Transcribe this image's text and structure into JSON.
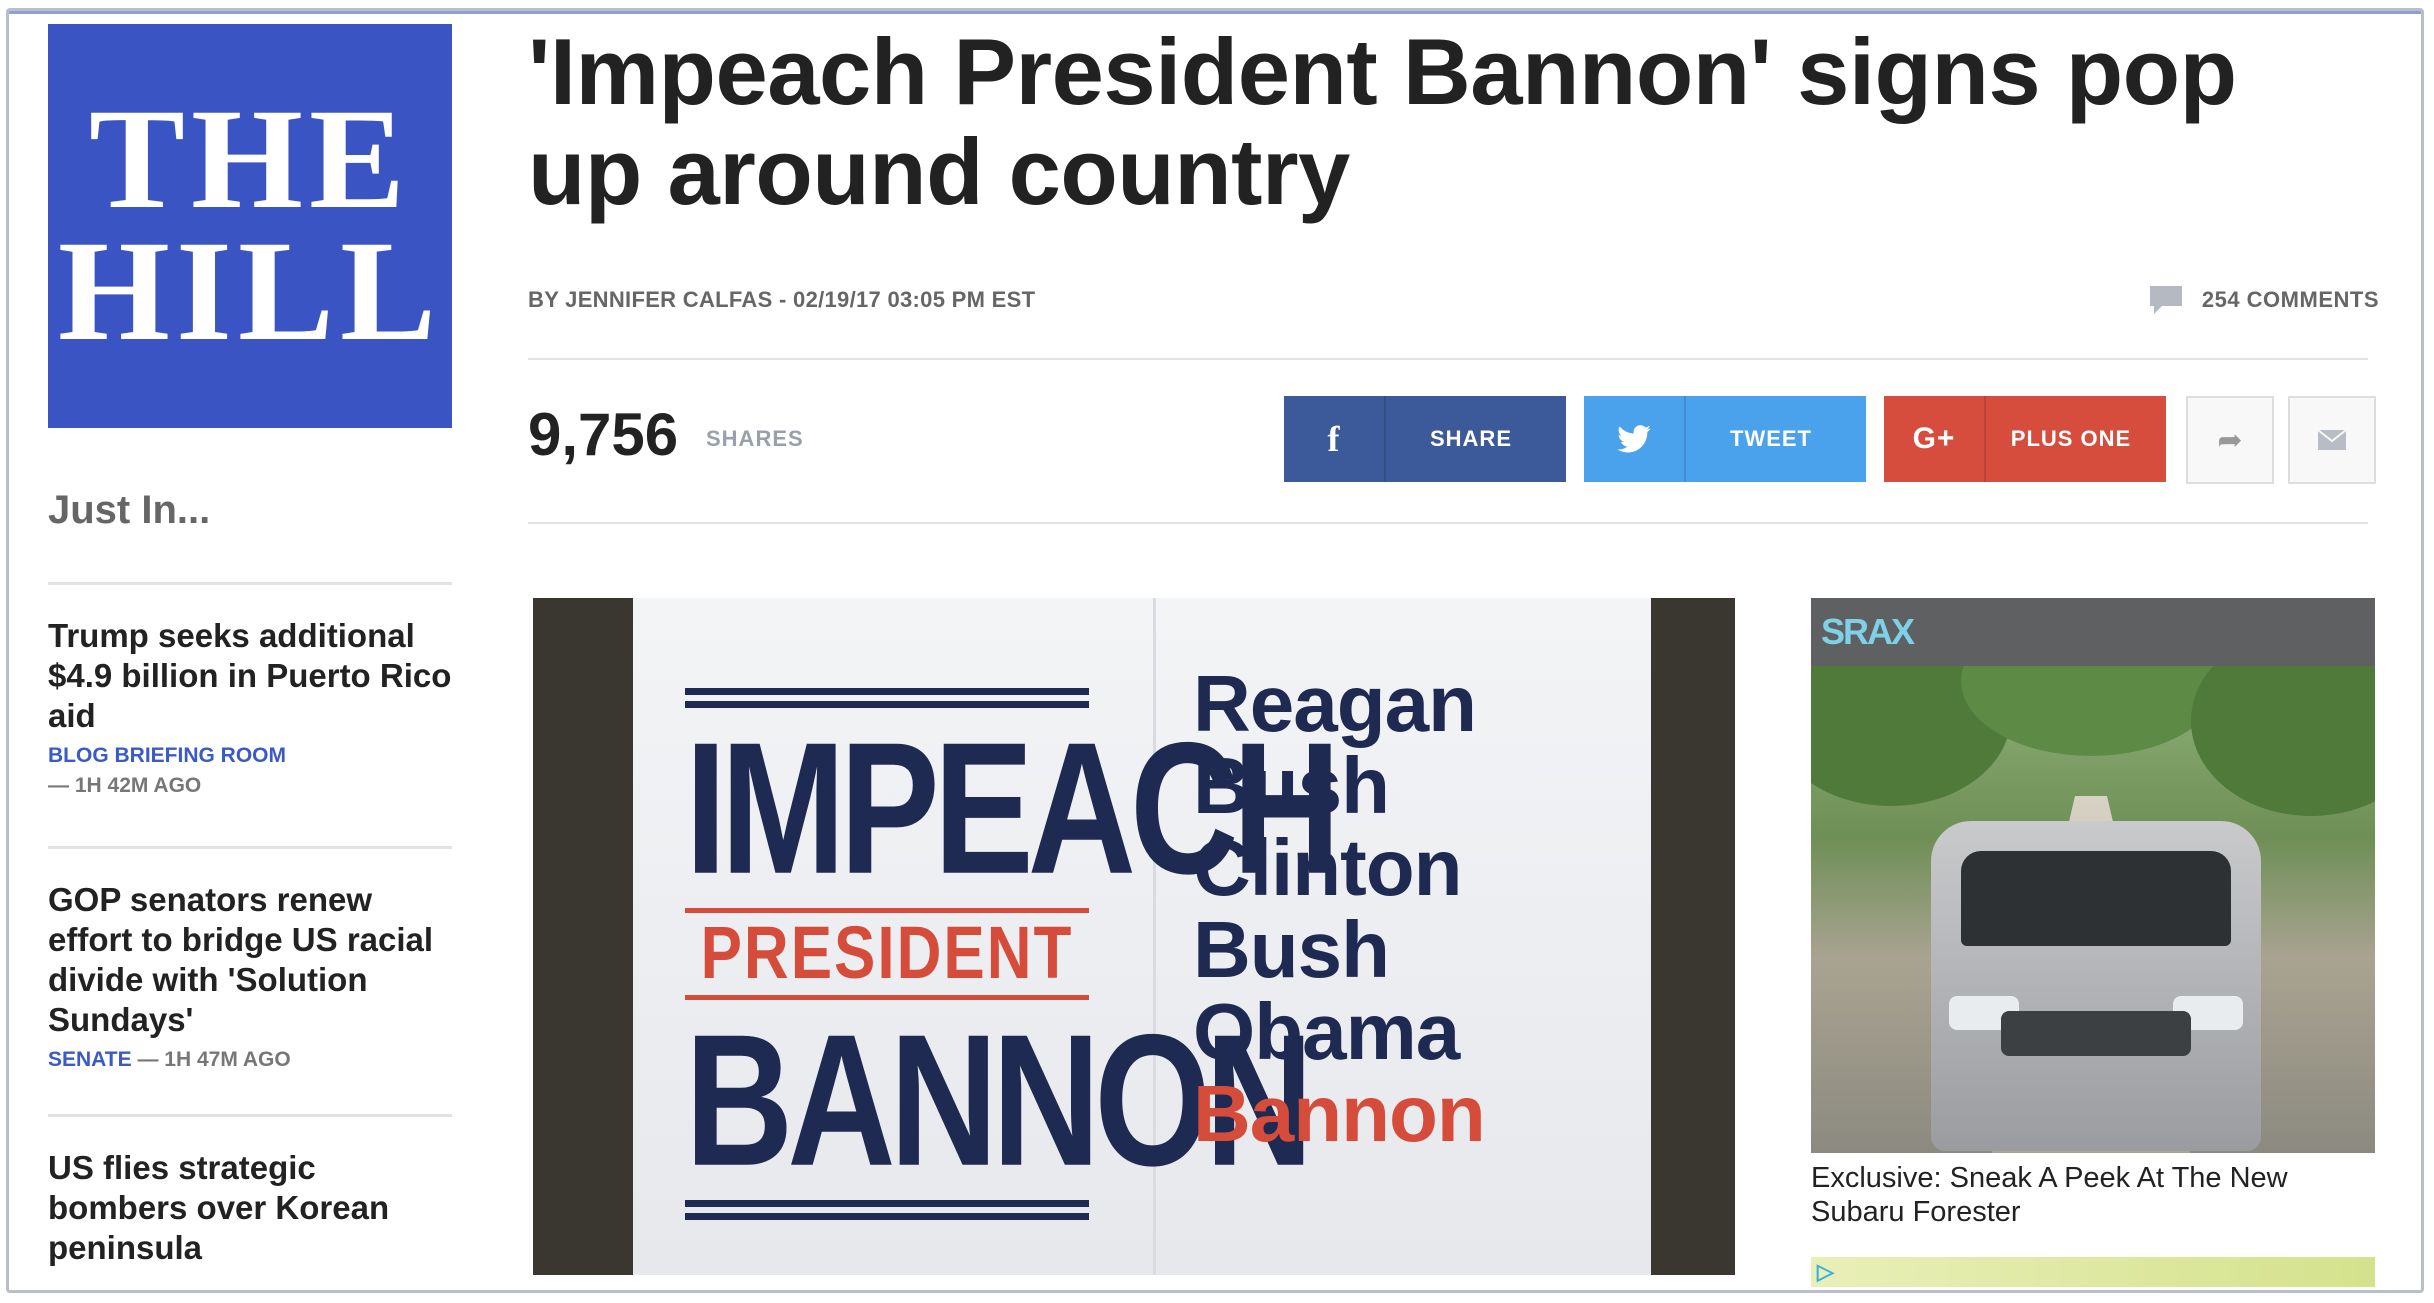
{
  "logo": {
    "line1": "THE",
    "line2": "HILL"
  },
  "sidebar": {
    "heading": "Just In...",
    "items": [
      {
        "title": "Trump seeks additional $4.9 billion in Puerto Rico aid",
        "category": "BLOG BRIEFING ROOM",
        "time": "— 1H 42M AGO"
      },
      {
        "title": "GOP senators renew effort to bridge US racial divide with 'Solution Sundays'",
        "category": "SENATE",
        "time": "— 1H 47M AGO"
      },
      {
        "title": "US flies strategic bombers over Korean peninsula",
        "category": "",
        "time": ""
      }
    ]
  },
  "article": {
    "headline": "'Impeach President Bannon' signs pop up around country",
    "byline": "BY JENNIFER CALFAS - 02/19/17 03:05 PM EST",
    "comments": "254 COMMENTS"
  },
  "share": {
    "count": "9,756",
    "count_label": "SHARES",
    "facebook": "SHARE",
    "twitter": "TWEET",
    "google": "PLUS ONE",
    "facebook_icon": "f",
    "google_icon": "G+"
  },
  "photo": {
    "impeach": "IMPEACH",
    "president": "PRESIDENT",
    "bannon": "BANNON",
    "names": [
      "Reagan",
      "Bush",
      "Clinton",
      "Bush",
      "Obama",
      "Bannon"
    ]
  },
  "ad": {
    "brand": "SRAX",
    "caption": "Exclusive: Sneak A Peek At The New Subaru Forester"
  },
  "colors": {
    "brand_blue": "#3a55c3",
    "facebook": "#3c5a9a",
    "twitter": "#4aa1ec",
    "google": "#d64d3e"
  }
}
